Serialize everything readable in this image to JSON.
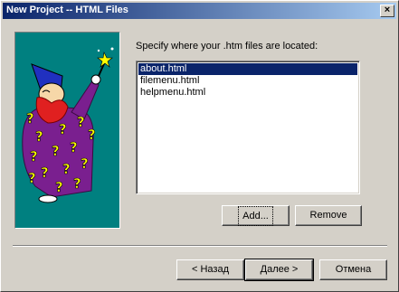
{
  "window": {
    "title": "New Project -- HTML Files"
  },
  "icons": {
    "close": "close-icon",
    "wizard": "wizard-illustration"
  },
  "instruction": "Specify where your .htm files are located:",
  "files": [
    {
      "name": "about.html",
      "selected": true
    },
    {
      "name": "filemenu.html",
      "selected": false
    },
    {
      "name": "helpmenu.html",
      "selected": false
    }
  ],
  "buttons": {
    "add": "Add...",
    "remove": "Remove",
    "back": "< Назад",
    "next": "Далее >",
    "cancel": "Отмена"
  },
  "colors": {
    "title_start": "#0a246a",
    "title_end": "#a6caf0",
    "selection": "#0a246a",
    "wizard_bg": "#008080",
    "robe": "#7a1f8f",
    "beard": "#e02020",
    "hat": "#2030c0",
    "question_marks": "#ffff00"
  }
}
